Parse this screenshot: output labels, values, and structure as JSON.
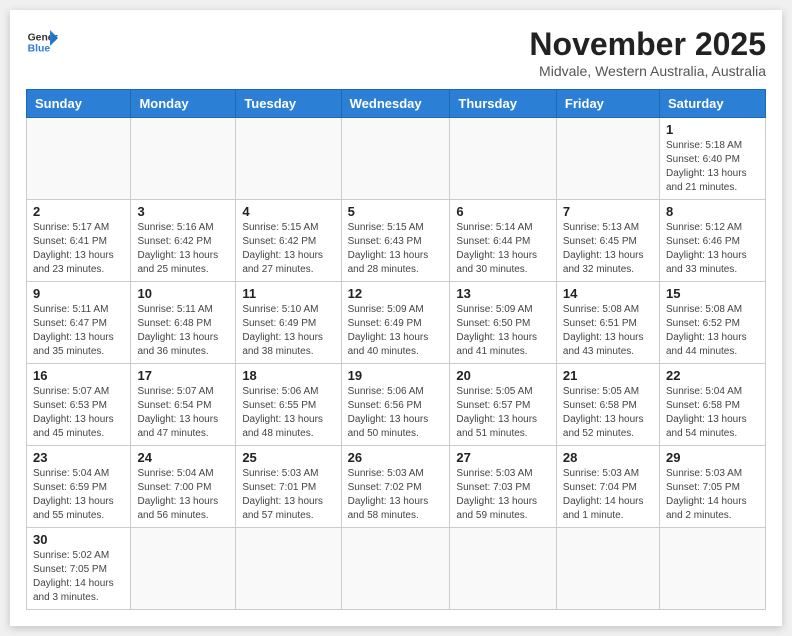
{
  "header": {
    "logo_general": "General",
    "logo_blue": "Blue",
    "title": "November 2025",
    "subtitle": "Midvale, Western Australia, Australia"
  },
  "weekdays": [
    "Sunday",
    "Monday",
    "Tuesday",
    "Wednesday",
    "Thursday",
    "Friday",
    "Saturday"
  ],
  "weeks": [
    [
      {
        "day": "",
        "info": ""
      },
      {
        "day": "",
        "info": ""
      },
      {
        "day": "",
        "info": ""
      },
      {
        "day": "",
        "info": ""
      },
      {
        "day": "",
        "info": ""
      },
      {
        "day": "",
        "info": ""
      },
      {
        "day": "1",
        "info": "Sunrise: 5:18 AM\nSunset: 6:40 PM\nDaylight: 13 hours\nand 21 minutes."
      }
    ],
    [
      {
        "day": "2",
        "info": "Sunrise: 5:17 AM\nSunset: 6:41 PM\nDaylight: 13 hours\nand 23 minutes."
      },
      {
        "day": "3",
        "info": "Sunrise: 5:16 AM\nSunset: 6:42 PM\nDaylight: 13 hours\nand 25 minutes."
      },
      {
        "day": "4",
        "info": "Sunrise: 5:15 AM\nSunset: 6:42 PM\nDaylight: 13 hours\nand 27 minutes."
      },
      {
        "day": "5",
        "info": "Sunrise: 5:15 AM\nSunset: 6:43 PM\nDaylight: 13 hours\nand 28 minutes."
      },
      {
        "day": "6",
        "info": "Sunrise: 5:14 AM\nSunset: 6:44 PM\nDaylight: 13 hours\nand 30 minutes."
      },
      {
        "day": "7",
        "info": "Sunrise: 5:13 AM\nSunset: 6:45 PM\nDaylight: 13 hours\nand 32 minutes."
      },
      {
        "day": "8",
        "info": "Sunrise: 5:12 AM\nSunset: 6:46 PM\nDaylight: 13 hours\nand 33 minutes."
      }
    ],
    [
      {
        "day": "9",
        "info": "Sunrise: 5:11 AM\nSunset: 6:47 PM\nDaylight: 13 hours\nand 35 minutes."
      },
      {
        "day": "10",
        "info": "Sunrise: 5:11 AM\nSunset: 6:48 PM\nDaylight: 13 hours\nand 36 minutes."
      },
      {
        "day": "11",
        "info": "Sunrise: 5:10 AM\nSunset: 6:49 PM\nDaylight: 13 hours\nand 38 minutes."
      },
      {
        "day": "12",
        "info": "Sunrise: 5:09 AM\nSunset: 6:49 PM\nDaylight: 13 hours\nand 40 minutes."
      },
      {
        "day": "13",
        "info": "Sunrise: 5:09 AM\nSunset: 6:50 PM\nDaylight: 13 hours\nand 41 minutes."
      },
      {
        "day": "14",
        "info": "Sunrise: 5:08 AM\nSunset: 6:51 PM\nDaylight: 13 hours\nand 43 minutes."
      },
      {
        "day": "15",
        "info": "Sunrise: 5:08 AM\nSunset: 6:52 PM\nDaylight: 13 hours\nand 44 minutes."
      }
    ],
    [
      {
        "day": "16",
        "info": "Sunrise: 5:07 AM\nSunset: 6:53 PM\nDaylight: 13 hours\nand 45 minutes."
      },
      {
        "day": "17",
        "info": "Sunrise: 5:07 AM\nSunset: 6:54 PM\nDaylight: 13 hours\nand 47 minutes."
      },
      {
        "day": "18",
        "info": "Sunrise: 5:06 AM\nSunset: 6:55 PM\nDaylight: 13 hours\nand 48 minutes."
      },
      {
        "day": "19",
        "info": "Sunrise: 5:06 AM\nSunset: 6:56 PM\nDaylight: 13 hours\nand 50 minutes."
      },
      {
        "day": "20",
        "info": "Sunrise: 5:05 AM\nSunset: 6:57 PM\nDaylight: 13 hours\nand 51 minutes."
      },
      {
        "day": "21",
        "info": "Sunrise: 5:05 AM\nSunset: 6:58 PM\nDaylight: 13 hours\nand 52 minutes."
      },
      {
        "day": "22",
        "info": "Sunrise: 5:04 AM\nSunset: 6:58 PM\nDaylight: 13 hours\nand 54 minutes."
      }
    ],
    [
      {
        "day": "23",
        "info": "Sunrise: 5:04 AM\nSunset: 6:59 PM\nDaylight: 13 hours\nand 55 minutes."
      },
      {
        "day": "24",
        "info": "Sunrise: 5:04 AM\nSunset: 7:00 PM\nDaylight: 13 hours\nand 56 minutes."
      },
      {
        "day": "25",
        "info": "Sunrise: 5:03 AM\nSunset: 7:01 PM\nDaylight: 13 hours\nand 57 minutes."
      },
      {
        "day": "26",
        "info": "Sunrise: 5:03 AM\nSunset: 7:02 PM\nDaylight: 13 hours\nand 58 minutes."
      },
      {
        "day": "27",
        "info": "Sunrise: 5:03 AM\nSunset: 7:03 PM\nDaylight: 13 hours\nand 59 minutes."
      },
      {
        "day": "28",
        "info": "Sunrise: 5:03 AM\nSunset: 7:04 PM\nDaylight: 14 hours\nand 1 minute."
      },
      {
        "day": "29",
        "info": "Sunrise: 5:03 AM\nSunset: 7:05 PM\nDaylight: 14 hours\nand 2 minutes."
      }
    ],
    [
      {
        "day": "30",
        "info": "Sunrise: 5:02 AM\nSunset: 7:05 PM\nDaylight: 14 hours\nand 3 minutes."
      },
      {
        "day": "",
        "info": ""
      },
      {
        "day": "",
        "info": ""
      },
      {
        "day": "",
        "info": ""
      },
      {
        "day": "",
        "info": ""
      },
      {
        "day": "",
        "info": ""
      },
      {
        "day": "",
        "info": ""
      }
    ]
  ]
}
